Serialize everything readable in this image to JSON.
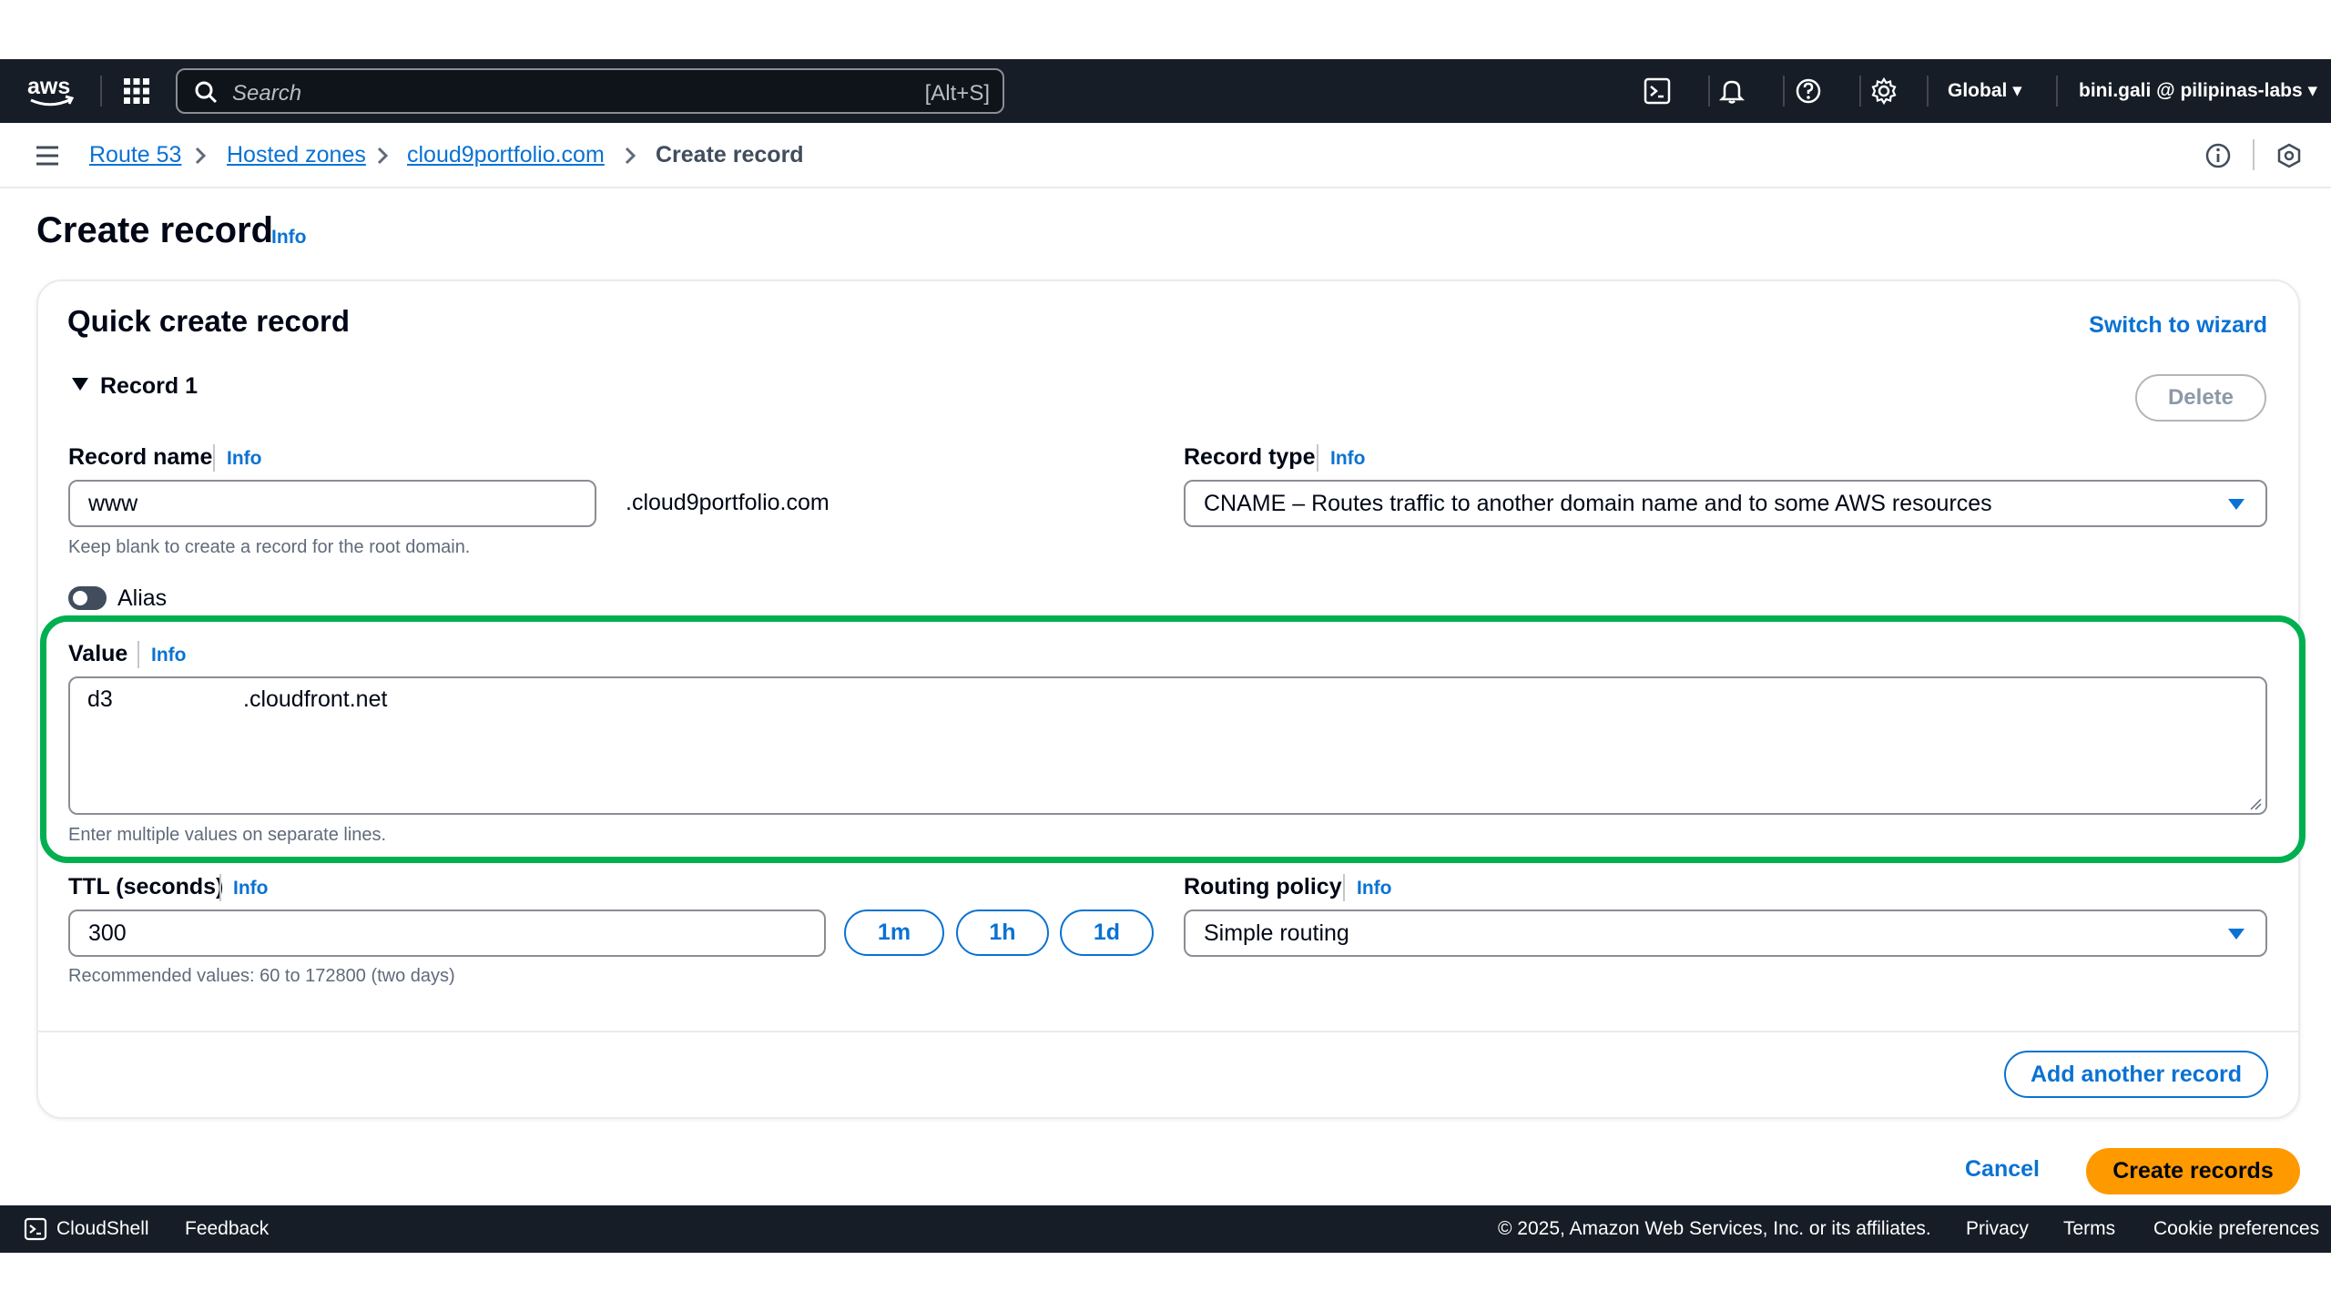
{
  "topnav": {
    "logo": "aws",
    "search_placeholder": "Search",
    "search_shortcut": "[Alt+S]",
    "region": "Global",
    "account": "bini.gali @ pilipinas-labs",
    "icons": [
      "cloudshell-icon",
      "bell-icon",
      "help-icon",
      "gear-icon"
    ]
  },
  "breadcrumb": {
    "items": [
      "Route 53",
      "Hosted zones",
      "cloud9portfolio.com"
    ],
    "current": "Create record"
  },
  "page": {
    "title": "Create record",
    "info": "Info"
  },
  "form": {
    "container_title": "Quick create record",
    "switch_wizard": "Switch to wizard",
    "record_label": "Record 1",
    "delete_label": "Delete",
    "record_name": {
      "label": "Record name",
      "info": "Info",
      "value": "www",
      "suffix": ".cloud9portfolio.com",
      "hint": "Keep blank to create a record for the root domain."
    },
    "record_type": {
      "label": "Record type",
      "info": "Info",
      "value": "CNAME – Routes traffic to another domain name and to some AWS resources"
    },
    "alias": {
      "label": "Alias",
      "enabled": false
    },
    "value_field": {
      "label": "Value",
      "info": "Info",
      "value_prefix": "d3",
      "value_suffix": ".cloudfront.net",
      "hint": "Enter multiple values on separate lines."
    },
    "ttl": {
      "label": "TTL (seconds)",
      "info": "Info",
      "value": "300",
      "presets": [
        "1m",
        "1h",
        "1d"
      ],
      "hint": "Recommended values: 60 to 172800 (two days)"
    },
    "routing_policy": {
      "label": "Routing policy",
      "info": "Info",
      "value": "Simple routing"
    },
    "add_another": "Add another record"
  },
  "actions": {
    "cancel": "Cancel",
    "create": "Create records"
  },
  "footer": {
    "cloudshell": "CloudShell",
    "feedback": "Feedback",
    "copyright": "© 2025, Amazon Web Services, Inc. or its affiliates.",
    "privacy": "Privacy",
    "terms": "Terms",
    "cookies": "Cookie preferences"
  },
  "colors": {
    "nav_bg": "#161d26",
    "link": "#0972d3",
    "primary_button": "#ff9900",
    "highlight": "#00b050"
  }
}
